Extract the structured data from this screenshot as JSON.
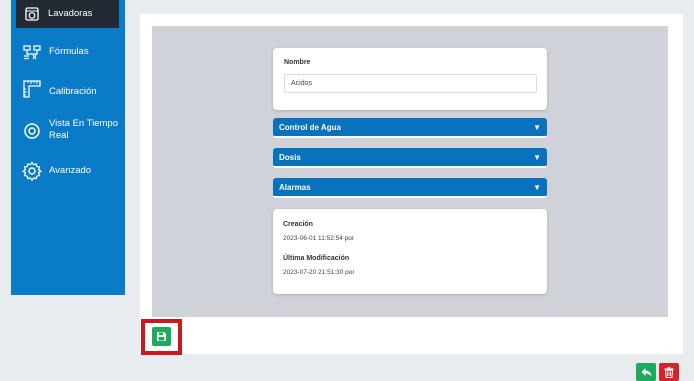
{
  "sidebar": {
    "items": [
      {
        "label": "Lavadoras",
        "icon": "washing-machine-icon",
        "active": true
      },
      {
        "label": "Fórmulas",
        "icon": "formula-icon"
      },
      {
        "label": "Calibración",
        "icon": "ruler-icon"
      },
      {
        "label": "Vista En Tiempo Real",
        "icon": "eye-icon"
      },
      {
        "label": "Avanzado",
        "icon": "gear-icon"
      }
    ]
  },
  "form": {
    "name_label": "Nombre",
    "name_value": "Acidos"
  },
  "sections": [
    {
      "label": "Control de Agua",
      "caret": "▼"
    },
    {
      "label": "Dosis",
      "caret": "▼"
    },
    {
      "label": "Alarmas",
      "caret": "▼"
    }
  ],
  "info": {
    "created_label": "Creación",
    "created_value": "2023-06-01 11:52:54 por",
    "modified_label": "Última Modificación",
    "modified_value": "2023-07-20 21:51:30 por"
  },
  "actions": {
    "save_icon": "save-icon",
    "back_icon": "reply-icon",
    "delete_icon": "trash-icon"
  },
  "colors": {
    "sidebar": "#0a7bc7",
    "section_bar": "#0a72bd",
    "save": "#1eaa5d",
    "delete": "#d3242a",
    "highlight": "#c8191e"
  }
}
